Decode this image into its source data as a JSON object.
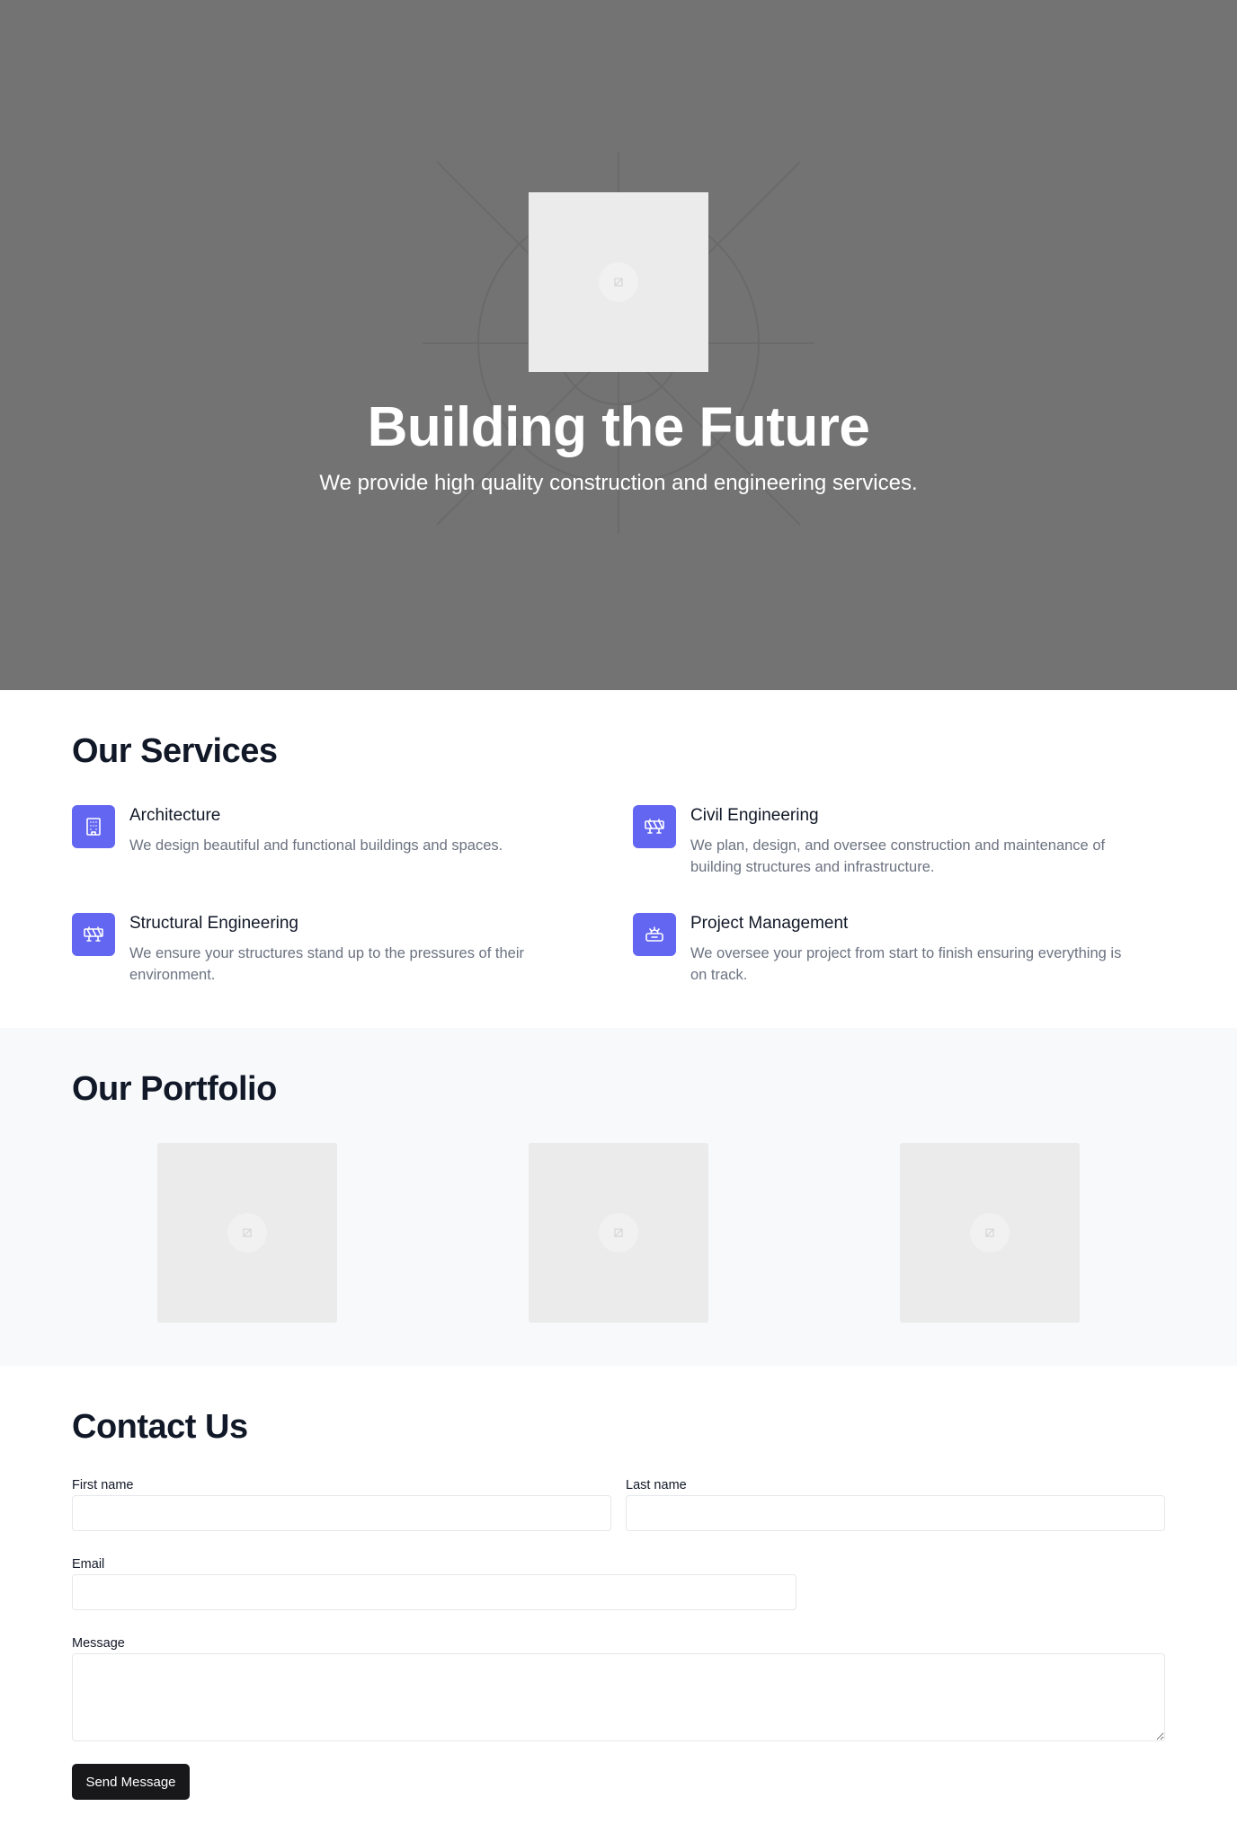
{
  "hero": {
    "title": "Building the Future",
    "subtitle": "We provide high quality construction and engineering services.",
    "background_color": "#737373",
    "image_icon": "image-placeholder-icon"
  },
  "services": {
    "title": "Our Services",
    "accent_color": "#6366f1",
    "items": [
      {
        "title": "Architecture",
        "description": "We design beautiful and functional buildings and spaces.",
        "icon": "building-icon"
      },
      {
        "title": "Civil Engineering",
        "description": "We plan, design, and oversee construction and maintenance of building structures and infrastructure.",
        "icon": "barrier-icon"
      },
      {
        "title": "Structural Engineering",
        "description": "We ensure your structures stand up to the pressures of their environment.",
        "icon": "barrier-icon"
      },
      {
        "title": "Project Management",
        "description": "We oversee your project from start to finish ensuring everything is on track.",
        "icon": "hard-hat-icon"
      }
    ]
  },
  "portfolio": {
    "title": "Our Portfolio",
    "items": [
      {
        "icon": "image-placeholder-icon"
      },
      {
        "icon": "image-placeholder-icon"
      },
      {
        "icon": "image-placeholder-icon"
      }
    ]
  },
  "contact": {
    "title": "Contact Us",
    "first_name_label": "First name",
    "first_name_value": "",
    "last_name_label": "Last name",
    "last_name_value": "",
    "email_label": "Email",
    "email_value": "",
    "message_label": "Message",
    "message_value": "",
    "submit_label": "Send Message"
  }
}
